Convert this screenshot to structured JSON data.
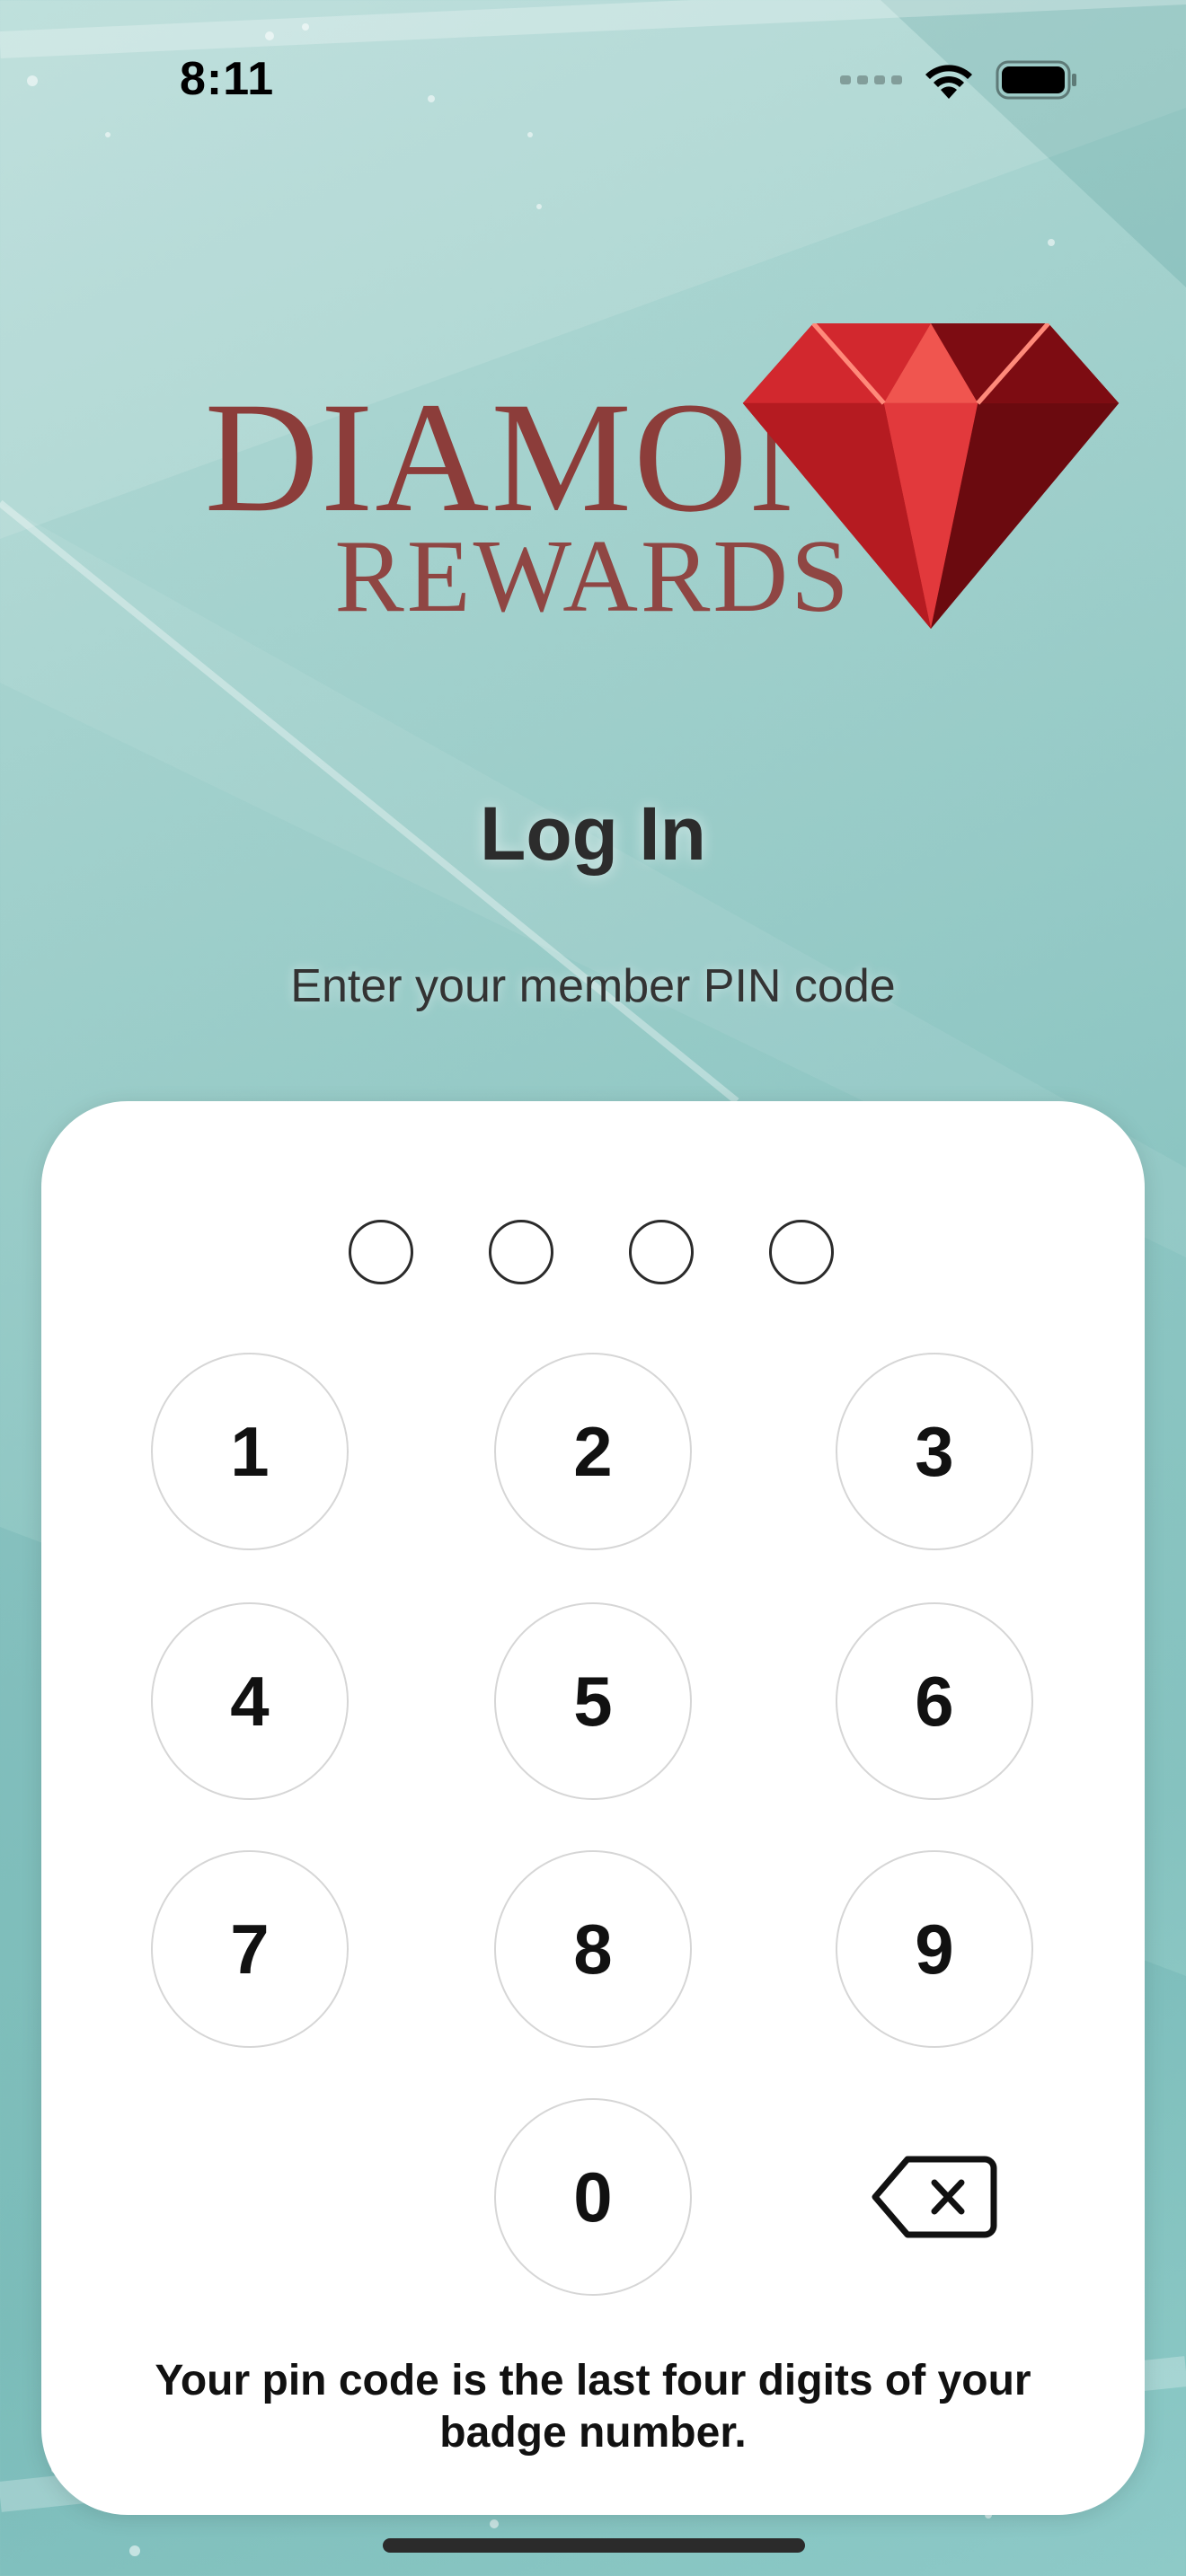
{
  "status_bar": {
    "time": "8:11"
  },
  "logo": {
    "line1": "DIAMOND",
    "line2": "REWARDS",
    "gem_icon": "red-diamond-gem"
  },
  "login": {
    "title": "Log In",
    "subtitle": "Enter your member PIN code"
  },
  "pin": {
    "length": 4,
    "entered": 0
  },
  "keypad": {
    "keys": [
      "1",
      "2",
      "3",
      "4",
      "5",
      "6",
      "7",
      "8",
      "9",
      "0"
    ],
    "delete_icon": "backspace-icon"
  },
  "hint": "Your pin code is the last four digits of your badge number.",
  "colors": {
    "logo": "#8c3d3a",
    "background": "#9fcfcb",
    "card": "#ffffff"
  }
}
